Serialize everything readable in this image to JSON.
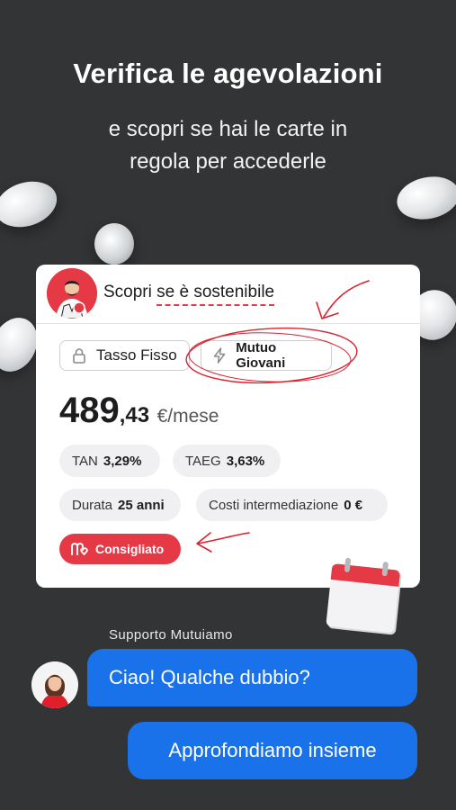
{
  "header": {
    "title": "Verifica le agevolazioni",
    "subtitle_line1": "e scopri se hai le carte in",
    "subtitle_line2": "regola per accederle"
  },
  "card": {
    "heading_prefix": "Scopri",
    "heading_underlined": "se è sostenibile",
    "chips": [
      {
        "label": "Tasso Fisso",
        "icon": "lock-icon"
      },
      {
        "label": "Mutuo Giovani",
        "icon": "lightning-icon"
      }
    ],
    "price": {
      "integer": "489",
      "decimal": ",43",
      "unit": "€/mese"
    },
    "rates": [
      {
        "label": "TAN",
        "value": "3,29%"
      },
      {
        "label": "TAEG",
        "value": "3,63%"
      }
    ],
    "details": [
      {
        "label": "Durata",
        "value": "25 anni"
      },
      {
        "label": "Costi intermediazione",
        "value": "0 €"
      }
    ],
    "badge": {
      "label": "Consigliato",
      "icon": "mutuiamo-logo-icon"
    }
  },
  "chat": {
    "sender": "Supporto Mutuiamo",
    "messages": [
      "Ciao! Qualche dubbio?",
      "Approfondiamo insieme"
    ]
  },
  "colors": {
    "background": "#333435",
    "accent_red": "#e63946",
    "bubble_blue": "#1a72ea"
  }
}
